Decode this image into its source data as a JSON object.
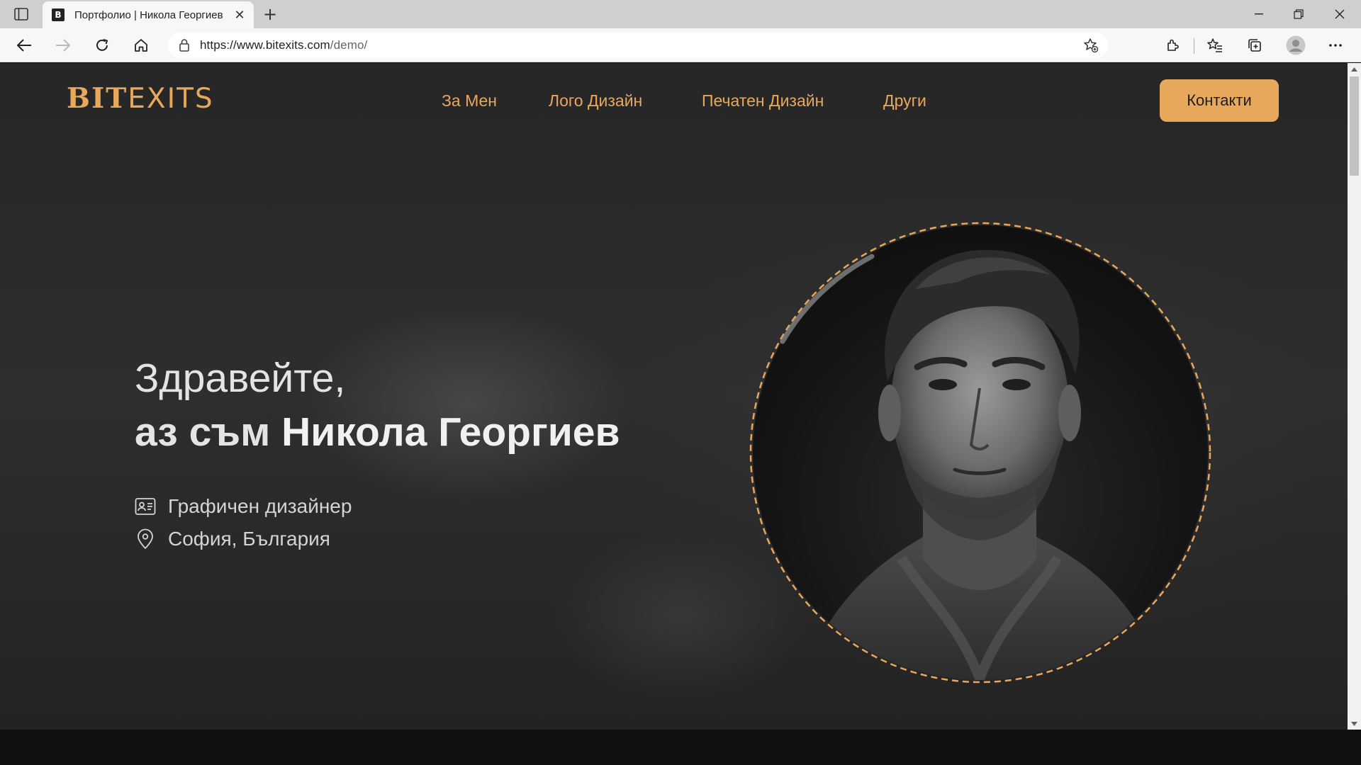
{
  "browser": {
    "tab_title": "Портфолио | Никола Георгиев",
    "tab_favicon": "B",
    "url_host": "https://www.bitexits.com",
    "url_path": "/demo/"
  },
  "site": {
    "logo_bold": "BIT",
    "logo_light": "EXITS",
    "nav": {
      "about": "За Мен",
      "logo_design": "Лого Дизайн",
      "print_design": "Печатен Дизайн",
      "other": "Други"
    },
    "contact_button": "Контакти"
  },
  "hero": {
    "greeting": "Здравейте,",
    "intro_prefix": "аз съм ",
    "name": "Никола Георгиев",
    "profession": "Графичен дизайнер",
    "location": "София, България"
  },
  "colors": {
    "accent": "#e8a85c",
    "background": "#2a2a2a",
    "text": "#e4e4e4"
  },
  "icons": {
    "profession": "id-card-icon",
    "location": "map-pin-icon"
  }
}
